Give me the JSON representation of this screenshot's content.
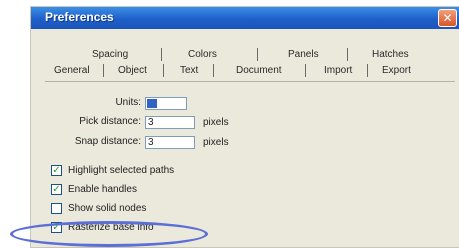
{
  "dialog": {
    "title": "Preferences",
    "close_glyph": "✕"
  },
  "tabs_top": [
    "Spacing",
    "Colors",
    "Panels",
    "Hatches"
  ],
  "tabs_bottom": [
    "General",
    "Object",
    "Text",
    "Document",
    "Import",
    "Export"
  ],
  "form": {
    "units_label": "Units:",
    "units_value": "",
    "pick_label": "Pick distance:",
    "pick_value": "3",
    "pick_unit": "pixels",
    "snap_label": "Snap distance:",
    "snap_value": "3",
    "snap_unit": "pixels"
  },
  "checks": [
    {
      "label": "Highlight selected paths",
      "checked": true
    },
    {
      "label": "Enable handles",
      "checked": true
    },
    {
      "label": "Show solid nodes",
      "checked": false
    },
    {
      "label": "Rasterize base info",
      "checked": true
    }
  ],
  "colors": {
    "highlight_ellipse": "#5b6fd6",
    "titlebar": "#1f5fc8"
  }
}
